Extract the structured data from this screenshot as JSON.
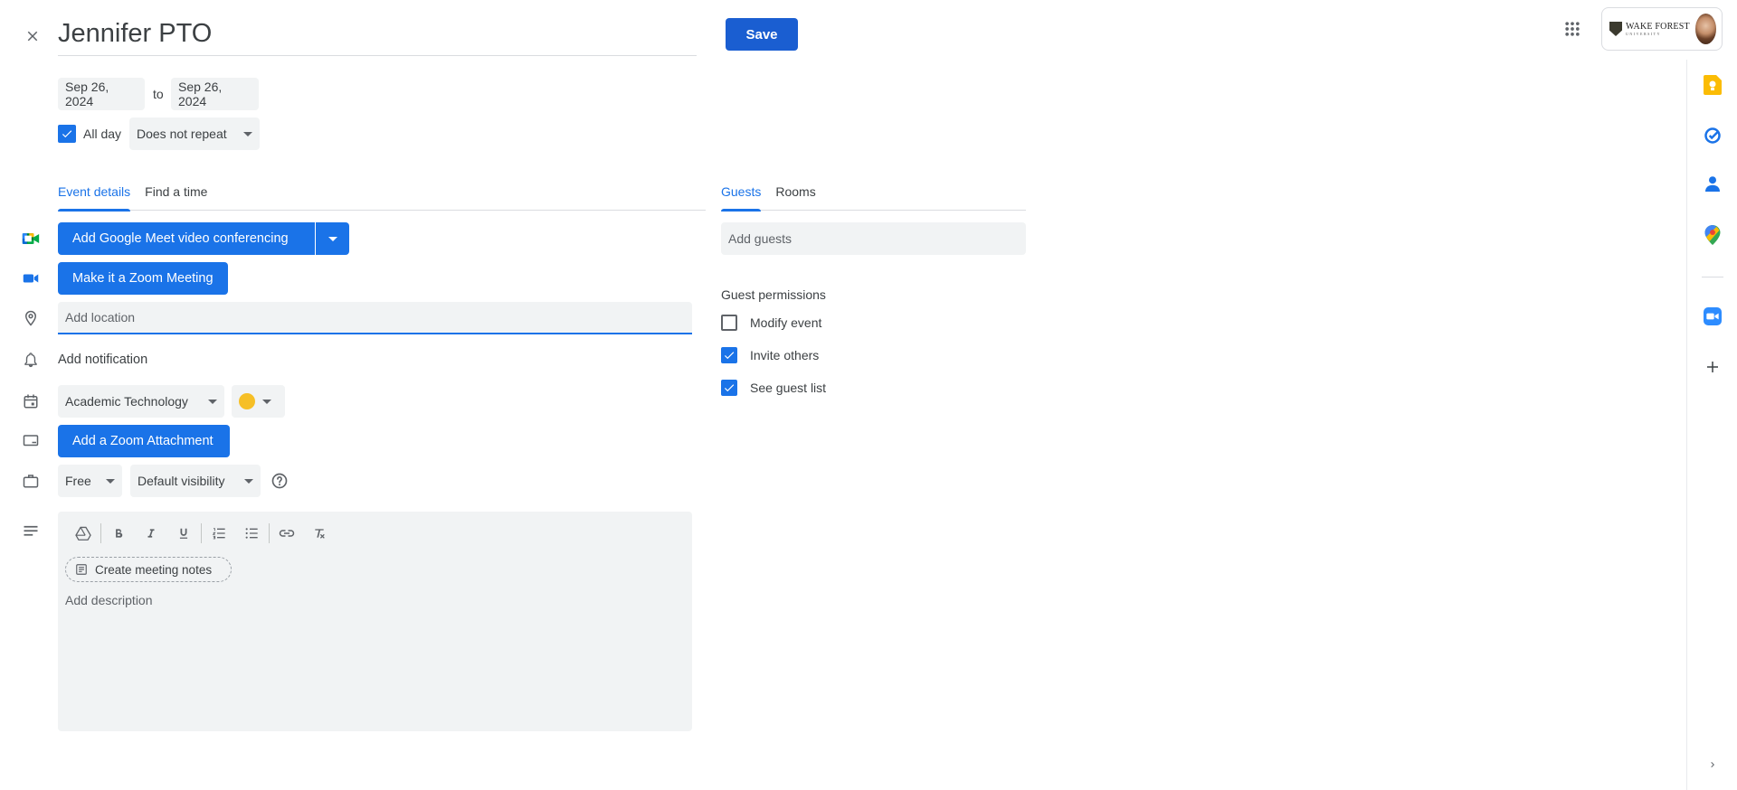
{
  "event": {
    "title": "Jennifer PTO",
    "save_label": "Save",
    "start_date": "Sep 26, 2024",
    "to_label": "to",
    "end_date": "Sep 26, 2024",
    "all_day_label": "All day",
    "all_day_checked": true,
    "repeat": "Does not repeat"
  },
  "account": {
    "org_name": "WAKE FOREST",
    "org_sub": "UNIVERSITY"
  },
  "tabs": {
    "left": [
      {
        "label": "Event details",
        "active": true
      },
      {
        "label": "Find a time",
        "active": false
      }
    ],
    "right": [
      {
        "label": "Guests",
        "active": true
      },
      {
        "label": "Rooms",
        "active": false
      }
    ]
  },
  "details": {
    "meet_label": "Add Google Meet video conferencing",
    "zoom_meeting_label": "Make it a Zoom Meeting",
    "location_placeholder": "Add location",
    "notification_label": "Add notification",
    "calendar": "Academic Technology",
    "event_color": "#f6bf26",
    "zoom_attachment_label": "Add a Zoom Attachment",
    "availability": "Free",
    "visibility": "Default visibility",
    "notes_label": "Create meeting notes",
    "description_placeholder": "Add description"
  },
  "guests": {
    "placeholder": "Add guests",
    "permissions_title": "Guest permissions",
    "permissions": [
      {
        "label": "Modify event",
        "checked": false
      },
      {
        "label": "Invite others",
        "checked": true
      },
      {
        "label": "See guest list",
        "checked": true
      }
    ]
  },
  "icons": {
    "left_column": [
      "google-meet-icon",
      "zoom-video-icon",
      "location-pin-icon",
      "bell-icon",
      "calendar-icon",
      "zoom-attachment-icon",
      "briefcase-icon",
      "description-icon"
    ],
    "side_panel": [
      "keep-icon",
      "tasks-icon",
      "contacts-icon",
      "maps-icon",
      "zoom-app-icon",
      "add-icon",
      "expand-chevron-icon"
    ]
  },
  "colors": {
    "primary": "#1a73e8",
    "save_button": "#1a5ed1"
  }
}
